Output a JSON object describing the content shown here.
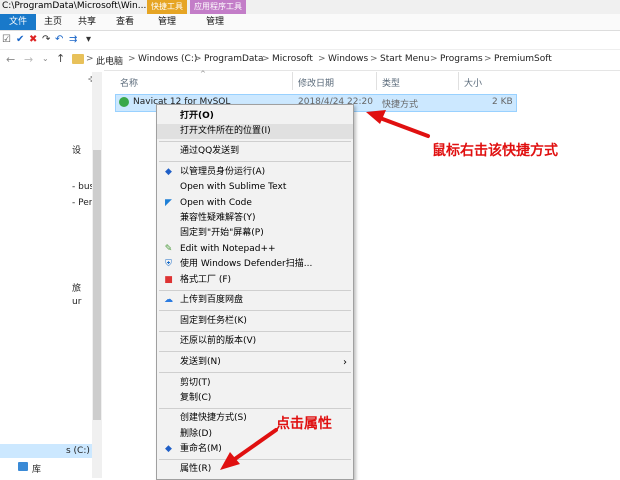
{
  "window": {
    "title": "C:\\ProgramData\\Microsoft\\Win...",
    "contextual_tabs": [
      "快捷工具",
      "应用程序工具"
    ]
  },
  "ribbon": {
    "tabs": [
      "文件",
      "主页",
      "共享",
      "查看",
      "管理",
      "管理"
    ],
    "qat_dropdown": "▾"
  },
  "address": {
    "crumbs": [
      "此电脑",
      "Windows (C:)",
      "ProgramData",
      "Microsoft",
      "Windows",
      "Start Menu",
      "Programs",
      "PremiumSoft"
    ],
    "separator": ">"
  },
  "columns": {
    "name": "名称",
    "date": "修改日期",
    "type": "类型",
    "size": "大小"
  },
  "file": {
    "name": "Navicat 12 for MySQL",
    "date": "2018/4/24 22:20",
    "type": "快捷方式",
    "size": "2 KB"
  },
  "nav": {
    "items": [
      "设",
      "- bus",
      "- Pers",
      "旅",
      "ur",
      "s (C:)",
      "库"
    ]
  },
  "menu": {
    "open": "打开(O)",
    "open_location": "打开文件所在的位置(I)",
    "qq_send": "通过QQ发送到",
    "run_as_admin": "以管理员身份运行(A)",
    "sublime": "Open with Sublime Text",
    "code": "Open with Code",
    "compat": "兼容性疑难解答(Y)",
    "pin_start": "固定到\"开始\"屏幕(P)",
    "notepad": "Edit with Notepad++",
    "defender": "使用 Windows Defender扫描...",
    "format_factory": "格式工厂 (F)",
    "baidu": "上传到百度网盘",
    "pin_taskbar": "固定到任务栏(K)",
    "restore": "还原以前的版本(V)",
    "send_to": "发送到(N)",
    "cut": "剪切(T)",
    "copy": "复制(C)",
    "create_shortcut": "创建快捷方式(S)",
    "delete": "删除(D)",
    "rename": "重命名(M)",
    "properties": "属性(R)"
  },
  "annotations": {
    "right_click": "鼠标右击该快捷方式",
    "click_properties": "点击属性"
  },
  "colors": {
    "accent": "#1979ca",
    "tools_tab": "#e6a524",
    "app_tools_tab": "#c37dc8",
    "annotation": "#e01010",
    "selection": "#cce8ff"
  }
}
